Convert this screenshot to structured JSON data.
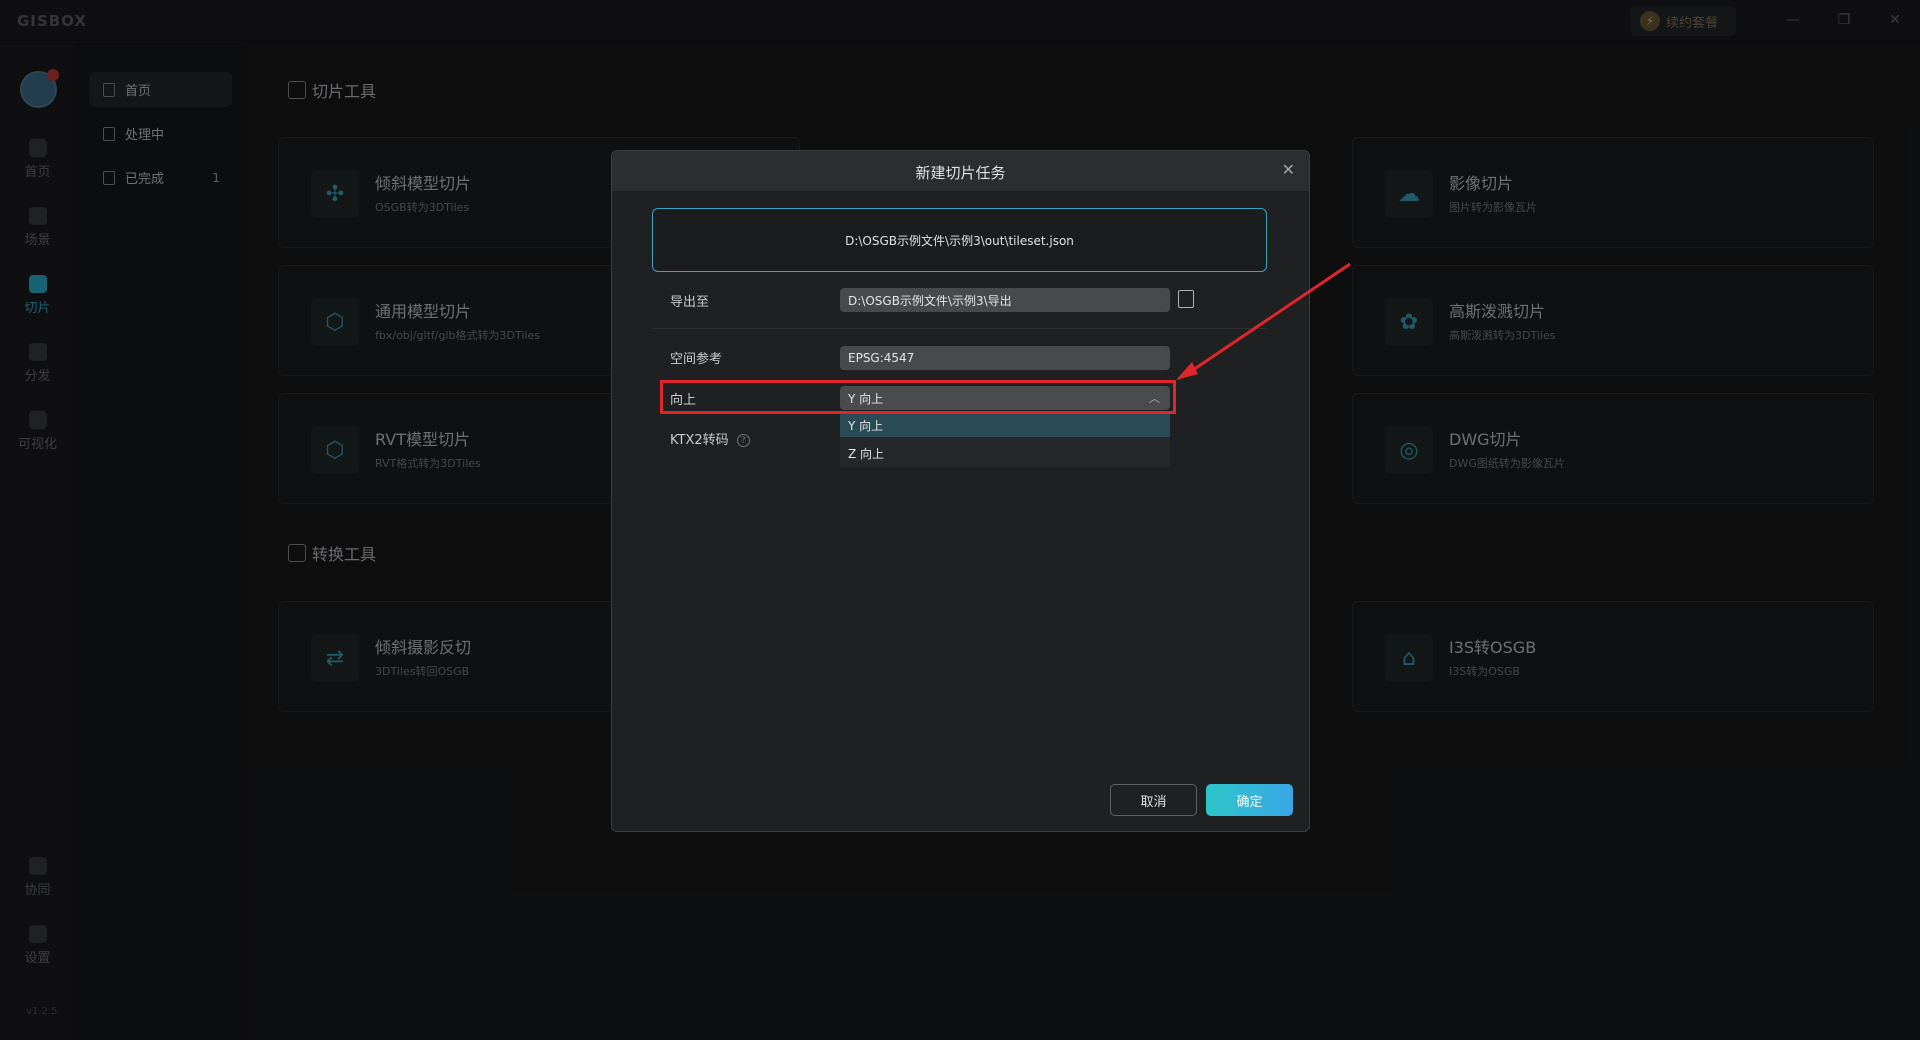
{
  "app": {
    "logo": "GISBOX",
    "package_button": "续约套餐",
    "window_controls": [
      "—",
      "❐",
      "✕"
    ],
    "version": "v1.2.5"
  },
  "rail": {
    "items": [
      {
        "label": "首页",
        "icon": "home-icon"
      },
      {
        "label": "场景",
        "icon": "scene-cube-icon"
      },
      {
        "label": "切片",
        "icon": "slice-icon",
        "active": true
      },
      {
        "label": "分发",
        "icon": "publish-icon"
      },
      {
        "label": "可视化",
        "icon": "visual-icon"
      }
    ],
    "bottom_items": [
      {
        "label": "协同",
        "icon": "lock-icon"
      },
      {
        "label": "设置",
        "icon": "gear-icon"
      }
    ]
  },
  "nav": {
    "items": [
      {
        "label": "首页",
        "count": ""
      },
      {
        "label": "处理中",
        "count": ""
      },
      {
        "label": "已完成",
        "count": "1"
      }
    ]
  },
  "main": {
    "slice_tools_title": "切片工具",
    "convert_tools_title": "转换工具",
    "cards": [
      {
        "title": "倾斜模型切片",
        "desc": "OSGB转为3DTiles",
        "icon": "drone-icon"
      },
      {
        "title": "影像切片",
        "desc": "图片转为影像瓦片",
        "icon": "cloud-image-icon"
      },
      {
        "title": "通用模型切片",
        "desc": "fbx/obj/gltf/glb格式转为3DTiles",
        "icon": "cube-icon"
      },
      {
        "title": "高斯泼溅切片",
        "desc": "高斯泼溅转为3DTiles",
        "icon": "gaussian-dots-icon"
      },
      {
        "title": "RVT模型切片",
        "desc": "RVT格式转为3DTiles",
        "icon": "rvt-cube-icon"
      },
      {
        "title": "DWG切片",
        "desc": "DWG图纸转为影像瓦片",
        "icon": "dwg-circle-icon"
      },
      {
        "title": "倾斜摄影反切",
        "desc": "3DTiles转回OSGB",
        "icon": "reverse-slice-icon"
      },
      {
        "title": "I3S转OSGB",
        "desc": "I3S转为OSGB",
        "icon": "i3s-box-icon"
      }
    ]
  },
  "modal": {
    "title": "新建切片任务",
    "source_path": "D:\\OSGB示例文件\\示例3\\out\\tileset.json",
    "export_label": "导出至",
    "export_value": "D:\\OSGB示例文件\\示例3\\导出",
    "srs_label": "空间参考",
    "srs_value": "EPSG:4547",
    "up_label": "向上",
    "up_value": "Y 向上",
    "up_options": [
      "Y 向上",
      "Z 向上"
    ],
    "ktx2_label": "KTX2转码",
    "cancel": "取消",
    "ok": "确定"
  }
}
